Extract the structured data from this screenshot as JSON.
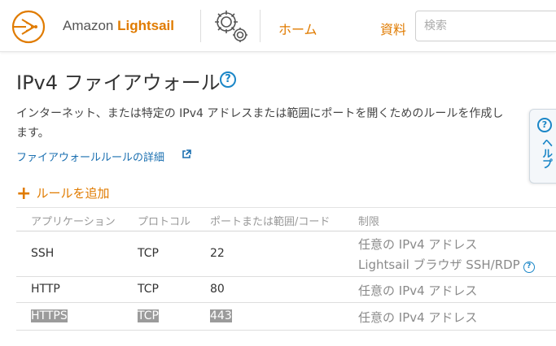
{
  "header": {
    "brand_prefix": "Amazon",
    "brand_name": "Lightsail",
    "nav_home": "ホーム",
    "nav_docs": "資料",
    "search_placeholder": "検索"
  },
  "page": {
    "title": "IPv4 ファイアウォール",
    "description": "インターネット、または特定の IPv4 アドレスまたは範囲にポートを開くためのルールを作成します。",
    "detail_link": "ファイアウォールルールの詳細",
    "add_rule": "ルールを追加"
  },
  "table": {
    "headers": [
      "アプリケーション",
      "プロトコル",
      "ポートまたは範囲/コード",
      "制限"
    ],
    "rows": [
      {
        "app": "SSH",
        "protocol": "TCP",
        "port": "22",
        "limit": "任意の IPv4 アドレス",
        "limit2": "Lightsail ブラウザ SSH/RDP"
      },
      {
        "app": "HTTP",
        "protocol": "TCP",
        "port": "80",
        "limit": "任意の IPv4 アドレス"
      },
      {
        "app": "HTTPS",
        "protocol": "TCP",
        "port": "443",
        "limit": "任意の IPv4 アドレス"
      }
    ]
  },
  "help_tab": {
    "label": "ヘルプ"
  },
  "colors": {
    "accent": "#e07b00",
    "link": "#1a6fb0",
    "help_blue": "#1a86c7",
    "selection": "#9b9b9b"
  }
}
